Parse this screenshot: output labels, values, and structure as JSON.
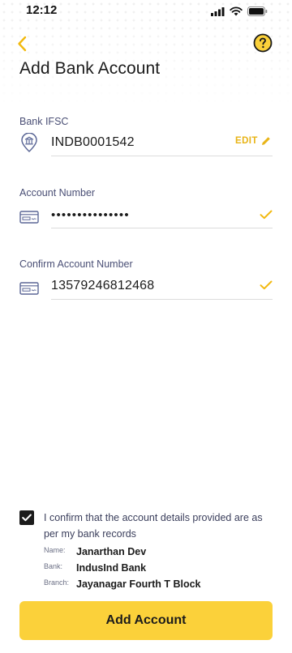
{
  "status_bar": {
    "time": "12:12"
  },
  "header": {
    "title": "Add Bank Account"
  },
  "fields": {
    "ifsc": {
      "label": "Bank IFSC",
      "value": "INDB0001542",
      "edit_label": "EDIT"
    },
    "account_number": {
      "label": "Account Number",
      "value": "•••••••••••••••"
    },
    "confirm_account_number": {
      "label": "Confirm Account Number",
      "value": "13579246812468"
    }
  },
  "confirmation": {
    "checked": true,
    "text": "I confirm that the account details provided are as per my bank records",
    "details": [
      {
        "key": "Name:",
        "value": "Janarthan Dev"
      },
      {
        "key": "Bank:",
        "value": "IndusInd Bank"
      },
      {
        "key": "Branch:",
        "value": "Jayanagar Fourth T Block"
      }
    ]
  },
  "actions": {
    "add_account_label": "Add Account"
  },
  "colors": {
    "accent": "#fbd13a",
    "accent_dark": "#e8b417",
    "label": "#4a4f75",
    "icon": "#5b6796"
  }
}
